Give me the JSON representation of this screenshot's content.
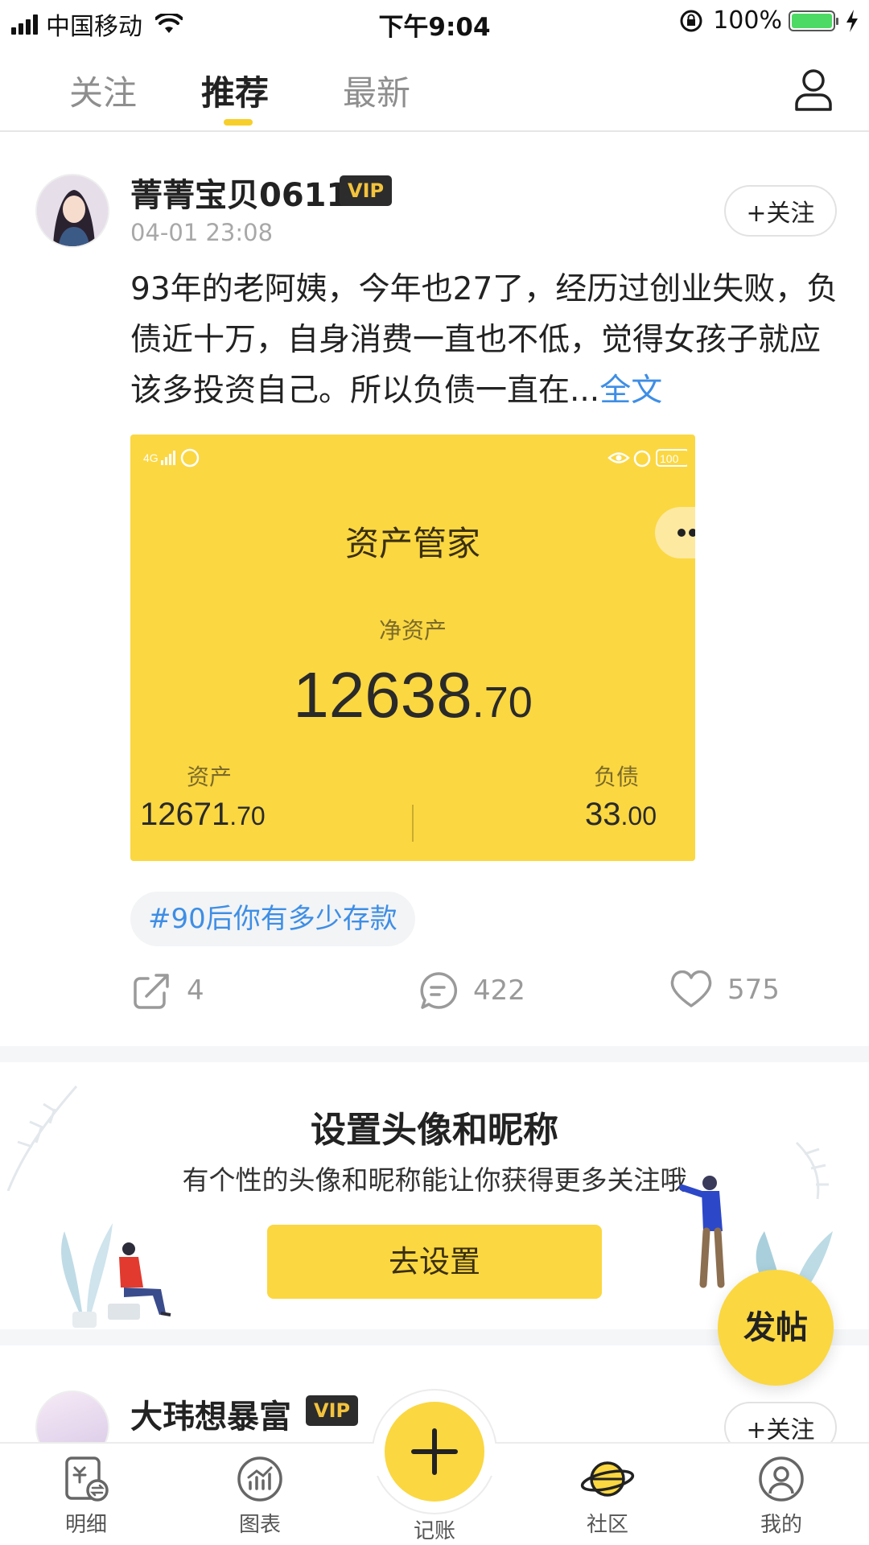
{
  "status_bar": {
    "carrier": "中国移动",
    "time": "下午9:04",
    "battery": "100%"
  },
  "top_tabs": [
    {
      "label": "关注",
      "active": false
    },
    {
      "label": "推荐",
      "active": true
    },
    {
      "label": "最新",
      "active": false
    }
  ],
  "post": {
    "username": "菁菁宝贝0611",
    "vip_badge": "VIP",
    "time": "04-01 23:08",
    "follow_label": "+关注",
    "text": "93年的老阿姨，今年也27了，经历过创业失败，负债近十万，自身消费一直也不低，觉得女孩子就应该多投资自己。所以负债一直在...",
    "more_link": "全文",
    "image": {
      "title": "资产管家",
      "net_label": "净资产",
      "net_int": "12638",
      "net_dec": ".70",
      "asset_label": "资产",
      "asset_int": "12671",
      "asset_dec": ".70",
      "debt_label": "负债",
      "debt_int": "33",
      "debt_dec": ".00"
    },
    "topic": "#90后你有多少存款",
    "shares": "4",
    "comments": "422",
    "likes": "575"
  },
  "promo": {
    "title": "设置头像和昵称",
    "subtitle": "有个性的头像和昵称能让你获得更多关注哦",
    "button": "去设置"
  },
  "next_post": {
    "username": "大玮想暴富",
    "vip_badge": "VIP",
    "follow_label": "+关注"
  },
  "fab_label": "发帖",
  "bottom_tabs": [
    {
      "label": "明细",
      "icon": "ledger-icon"
    },
    {
      "label": "图表",
      "icon": "chart-icon"
    },
    {
      "label": "记账",
      "icon": "plus-icon"
    },
    {
      "label": "社区",
      "icon": "planet-icon",
      "active": true
    },
    {
      "label": "我的",
      "icon": "user-icon"
    }
  ],
  "colors": {
    "accent": "#fbd741",
    "link": "#3e8ee5"
  }
}
